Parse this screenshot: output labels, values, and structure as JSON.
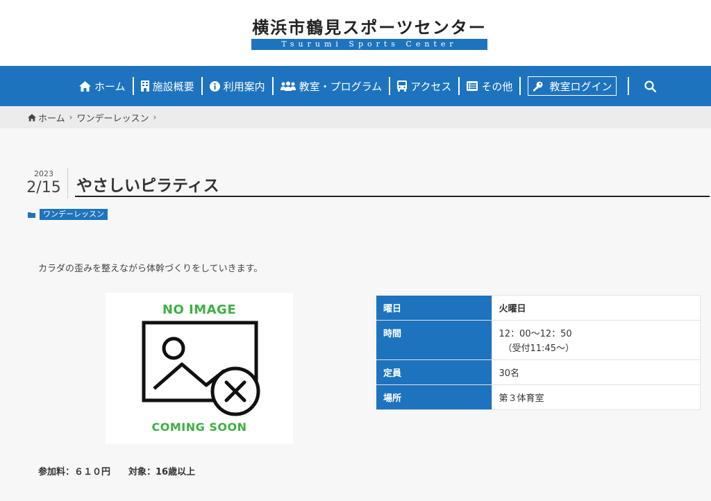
{
  "site": {
    "logo_jp": "横浜市鶴見スポーツセンター",
    "logo_en": "Tsurumi Sports Center"
  },
  "nav": {
    "items": [
      {
        "label": "ホーム",
        "icon": "home-icon"
      },
      {
        "label": "施設概要",
        "icon": "building-icon"
      },
      {
        "label": "利用案内",
        "icon": "info-icon"
      },
      {
        "label": "教室・プログラム",
        "icon": "users-icon"
      },
      {
        "label": "アクセス",
        "icon": "bus-icon"
      },
      {
        "label": "その他",
        "icon": "list-icon"
      }
    ],
    "login_label": "教室ログイン",
    "search_icon": "search-icon"
  },
  "breadcrumb": {
    "home": "ホーム",
    "current": "ワンデーレッスン"
  },
  "post": {
    "year": "2023",
    "month_day": "2/15",
    "title": "やさしいピラティス",
    "category": "ワンデーレッスン",
    "lead": "カラダの歪みを整えながら体幹づくりをしていきます。"
  },
  "noimage": {
    "top_text": "NO IMAGE",
    "bottom_text": "COMING SOON"
  },
  "info": {
    "rows": [
      {
        "label": "曜日",
        "value": "火曜日"
      },
      {
        "label": "時間",
        "value": "12：00～12：50",
        "sub": "（受付11:45～）"
      },
      {
        "label": "定員",
        "value": "30名"
      },
      {
        "label": "場所",
        "value": "第３体育室"
      }
    ]
  },
  "footer": {
    "fee": "参加料：６１０円",
    "target": "対象：16歳以上"
  },
  "colors": {
    "primary": "#1e73be",
    "noimage_green": "#3cb043"
  }
}
